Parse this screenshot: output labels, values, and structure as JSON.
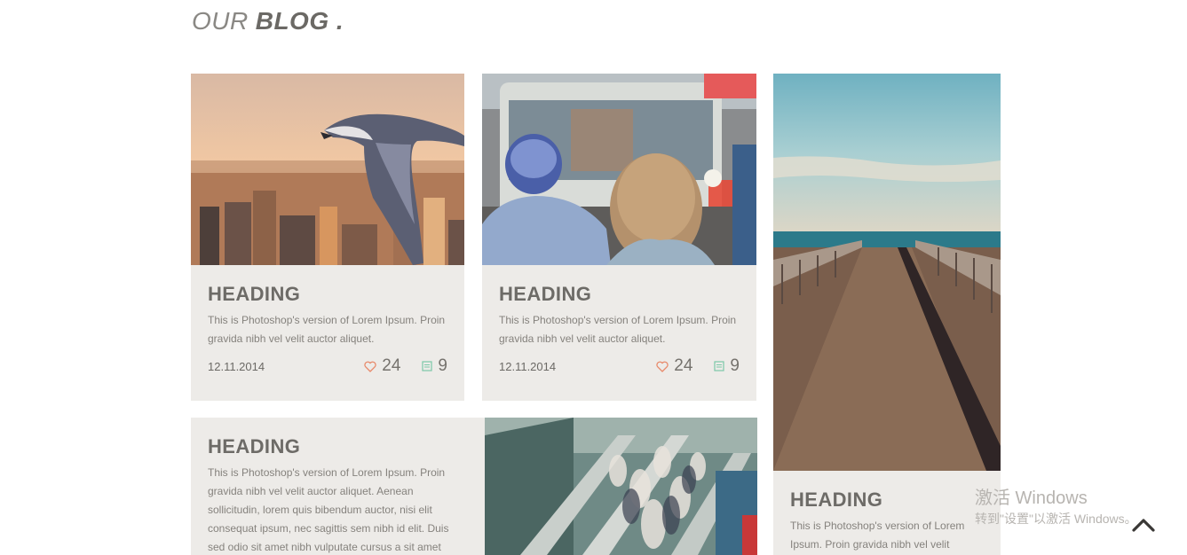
{
  "section": {
    "title_light": "OUR",
    "title_bold": "BLOG ."
  },
  "posts": [
    {
      "heading": "HEADING",
      "excerpt": "This is Photoshop's version of Lorem Ipsum. Proin gravida nibh vel velit auctor aliquet.",
      "date": "12.11.2014",
      "likes": "24",
      "comments": "9",
      "image": "seagull flying over city skyline"
    },
    {
      "heading": "HEADING",
      "excerpt": "This is Photoshop's version of Lorem Ipsum. Proin gravida nibh vel velit auctor aliquet.",
      "date": "12.11.2014",
      "likes": "24",
      "comments": "9",
      "image": "child and bus on city street"
    },
    {
      "heading": "HEADING",
      "excerpt": "This is Photoshop's version of Lorem Ipsum. Proin gravida nibh vel velit",
      "image": "wooden pier over the sea"
    },
    {
      "heading": "HEADING",
      "excerpt": "This is Photoshop's version of Lorem Ipsum. Proin gravida nibh vel velit auctor aliquet. Aenean sollicitudin, lorem quis bibendum auctor, nisi elit consequat ipsum, nec sagittis sem nibh id elit. Duis sed odio sit amet nibh vulputate cursus a sit amet"
    },
    {
      "image": "crowd on escalators"
    }
  ],
  "icons": {
    "like": "heart-icon",
    "comment": "comment-icon",
    "scroll_top": "chevron-up-icon"
  },
  "colors": {
    "card_bg": "#edebe8",
    "heart": "#e8896a",
    "comment": "#7cc8a8",
    "text": "#6b6965"
  },
  "watermark": {
    "title": "激活 Windows",
    "subtitle": "转到\"设置\"以激活 Windows。"
  }
}
